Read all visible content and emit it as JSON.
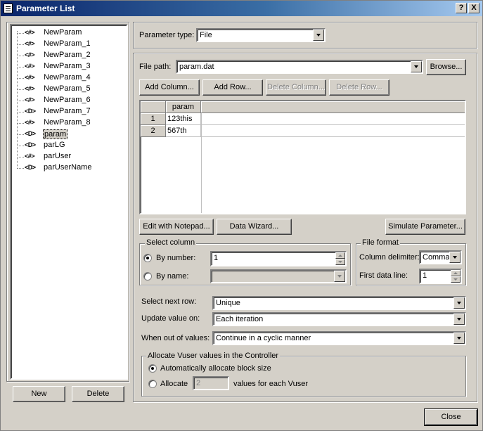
{
  "window": {
    "title": "Parameter List",
    "help_btn": "?",
    "close_btn": "X"
  },
  "tree": {
    "items": [
      {
        "icon": "<#>",
        "label": "NewParam"
      },
      {
        "icon": "<#>",
        "label": "NewParam_1"
      },
      {
        "icon": "<#>",
        "label": "NewParam_2"
      },
      {
        "icon": "<#>",
        "label": "NewParam_3"
      },
      {
        "icon": "<#>",
        "label": "NewParam_4"
      },
      {
        "icon": "<#>",
        "label": "NewParam_5"
      },
      {
        "icon": "<#>",
        "label": "NewParam_6"
      },
      {
        "icon": "<D>",
        "label": "NewParam_7"
      },
      {
        "icon": "<#>",
        "label": "NewParam_8"
      },
      {
        "icon": "<D>",
        "label": "param"
      },
      {
        "icon": "<D>",
        "label": "parLG"
      },
      {
        "icon": "<#>",
        "label": "parUser"
      },
      {
        "icon": "<D>",
        "label": "parUserName"
      }
    ],
    "selected_index": 9
  },
  "left_buttons": {
    "new": "New",
    "delete": "Delete"
  },
  "param_type": {
    "label": "Parameter type:",
    "value": "File"
  },
  "file_path": {
    "label": "File path:",
    "value": "param.dat",
    "browse": "Browse..."
  },
  "table_buttons": {
    "add_column": "Add Column...",
    "add_row": "Add Row...",
    "delete_column": "Delete Column...",
    "delete_row": "Delete Row..."
  },
  "grid": {
    "column": "param",
    "rows": [
      {
        "num": "1",
        "value": "123this"
      },
      {
        "num": "2",
        "value": "567th"
      }
    ]
  },
  "grid_buttons": {
    "edit_notepad": "Edit with Notepad...",
    "data_wizard": "Data Wizard...",
    "simulate": "Simulate Parameter..."
  },
  "select_column": {
    "legend": "Select column",
    "by_number_label": "By number:",
    "by_number_value": "1",
    "by_name_label": "By name:"
  },
  "file_format": {
    "legend": "File format",
    "delimiter_label": "Column delimiter:",
    "delimiter_value": "Comma",
    "first_line_label": "First data line:",
    "first_line_value": "1"
  },
  "select_next_row": {
    "label": "Select next row:",
    "value": "Unique"
  },
  "update_value_on": {
    "label": "Update value on:",
    "value": "Each iteration"
  },
  "when_out": {
    "label": "When out of values:",
    "value": "Continue in a cyclic manner"
  },
  "allocate": {
    "legend": "Allocate Vuser values in the Controller",
    "auto_label": "Automatically allocate block size",
    "allocate_label": "Allocate",
    "allocate_value": "2",
    "allocate_suffix": "values for each Vuser"
  },
  "close_button": "Close"
}
